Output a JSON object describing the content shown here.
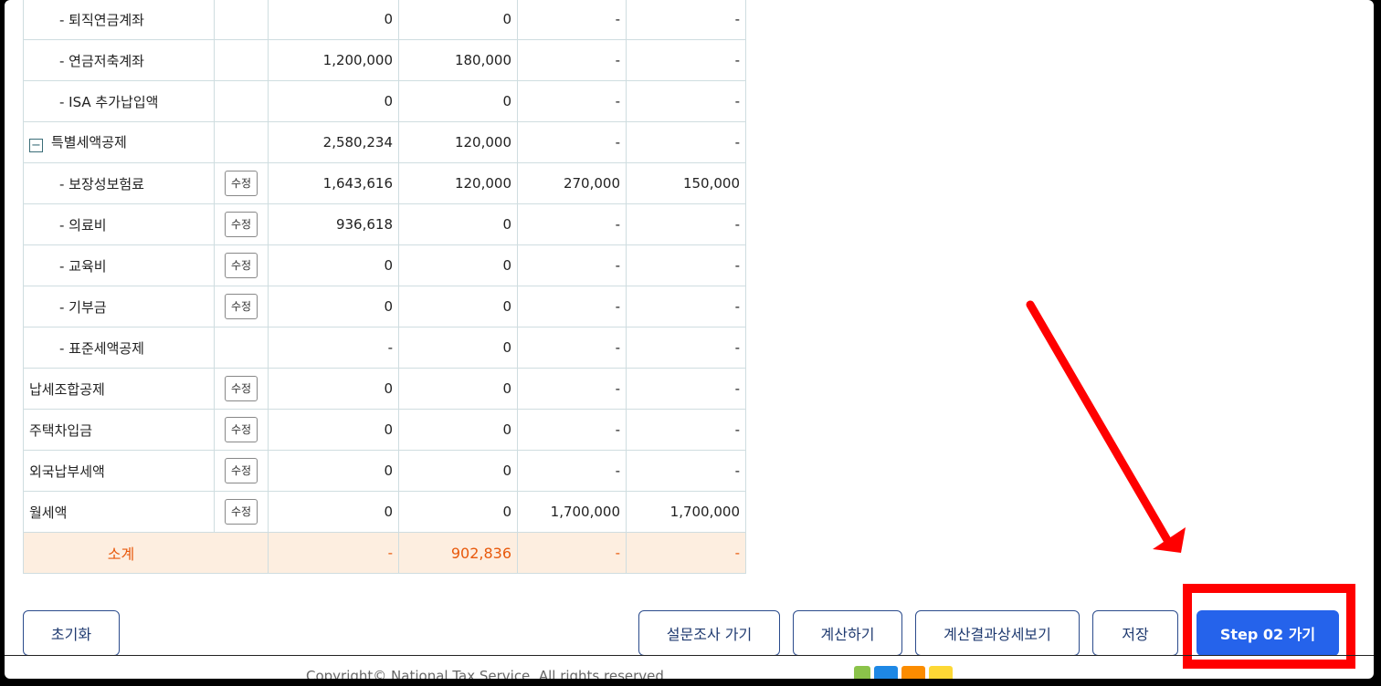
{
  "table": {
    "rows": [
      {
        "label": "- 퇴직연금계좌",
        "level": "sub",
        "edit": false,
        "v1": "0",
        "v2": "0",
        "v3": "-",
        "v4": "-"
      },
      {
        "label": "- 연금저축계좌",
        "level": "sub",
        "edit": false,
        "v1": "1,200,000",
        "v2": "180,000",
        "v3": "-",
        "v4": "-"
      },
      {
        "label": "- ISA 추가납입액",
        "level": "sub",
        "edit": false,
        "v1": "0",
        "v2": "0",
        "v3": "-",
        "v4": "-"
      },
      {
        "label": "특별세액공제",
        "level": "group",
        "edit": false,
        "v1": "2,580,234",
        "v2": "120,000",
        "v3": "-",
        "v4": "-"
      },
      {
        "label": "- 보장성보험료",
        "level": "sub",
        "edit": true,
        "v1": "1,643,616",
        "v2": "120,000",
        "v3": "270,000",
        "v4": "150,000"
      },
      {
        "label": "- 의료비",
        "level": "sub",
        "edit": true,
        "v1": "936,618",
        "v2": "0",
        "v3": "-",
        "v4": "-"
      },
      {
        "label": "- 교육비",
        "level": "sub",
        "edit": true,
        "v1": "0",
        "v2": "0",
        "v3": "-",
        "v4": "-"
      },
      {
        "label": "- 기부금",
        "level": "sub",
        "edit": true,
        "v1": "0",
        "v2": "0",
        "v3": "-",
        "v4": "-"
      },
      {
        "label": "- 표준세액공제",
        "level": "sub",
        "edit": false,
        "v1": "-",
        "v2": "0",
        "v3": "-",
        "v4": "-"
      },
      {
        "label": "납세조합공제",
        "level": "top",
        "edit": true,
        "v1": "0",
        "v2": "0",
        "v3": "-",
        "v4": "-"
      },
      {
        "label": "주택차입금",
        "level": "top",
        "edit": true,
        "v1": "0",
        "v2": "0",
        "v3": "-",
        "v4": "-"
      },
      {
        "label": "외국납부세액",
        "level": "top",
        "edit": true,
        "v1": "0",
        "v2": "0",
        "v3": "-",
        "v4": "-"
      },
      {
        "label": "월세액",
        "level": "top",
        "edit": true,
        "v1": "0",
        "v2": "0",
        "v3": "1,700,000",
        "v4": "1,700,000"
      }
    ],
    "edit_label": "수정",
    "collapse_symbol": "−",
    "subtotal": {
      "label": "소계",
      "v1": "-",
      "v2": "902,836",
      "v3": "-",
      "v4": "-"
    }
  },
  "buttons": {
    "reset": "초기화",
    "survey": "설문조사 가기",
    "calculate": "계산하기",
    "detail": "계산결과상세보기",
    "save": "저장",
    "next_step": "Step 02 가기"
  },
  "footer": {
    "copyright": "Copyright© National Tax Service. All rights reserved."
  },
  "colors": {
    "primary": "#2563eb",
    "highlight": "#ff0000",
    "subtotal_bg": "#fdeee0",
    "subtotal_text": "#e8590c"
  }
}
